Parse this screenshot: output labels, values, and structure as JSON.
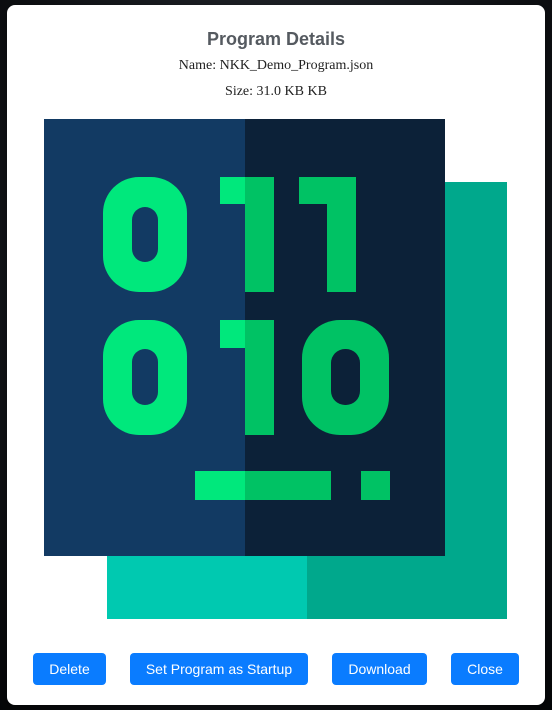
{
  "modal": {
    "title": "Program Details",
    "name_line": "Name: NKK_Demo_Program.json",
    "size_line": "Size: 31.0 KB KB"
  },
  "preview": {
    "icon": "binary-code-icon",
    "colors": {
      "panel_light": "#123a63",
      "panel_dark": "#0c2138",
      "shadow_light": "#00c9b0",
      "shadow_dark": "#00a88c",
      "digit_light": "#00e87c",
      "digit_dark": "#00c264"
    }
  },
  "buttons": {
    "delete": "Delete",
    "set_startup": "Set Program as Startup",
    "download": "Download",
    "close": "Close"
  },
  "colors": {
    "primary": "#0a7cff"
  }
}
